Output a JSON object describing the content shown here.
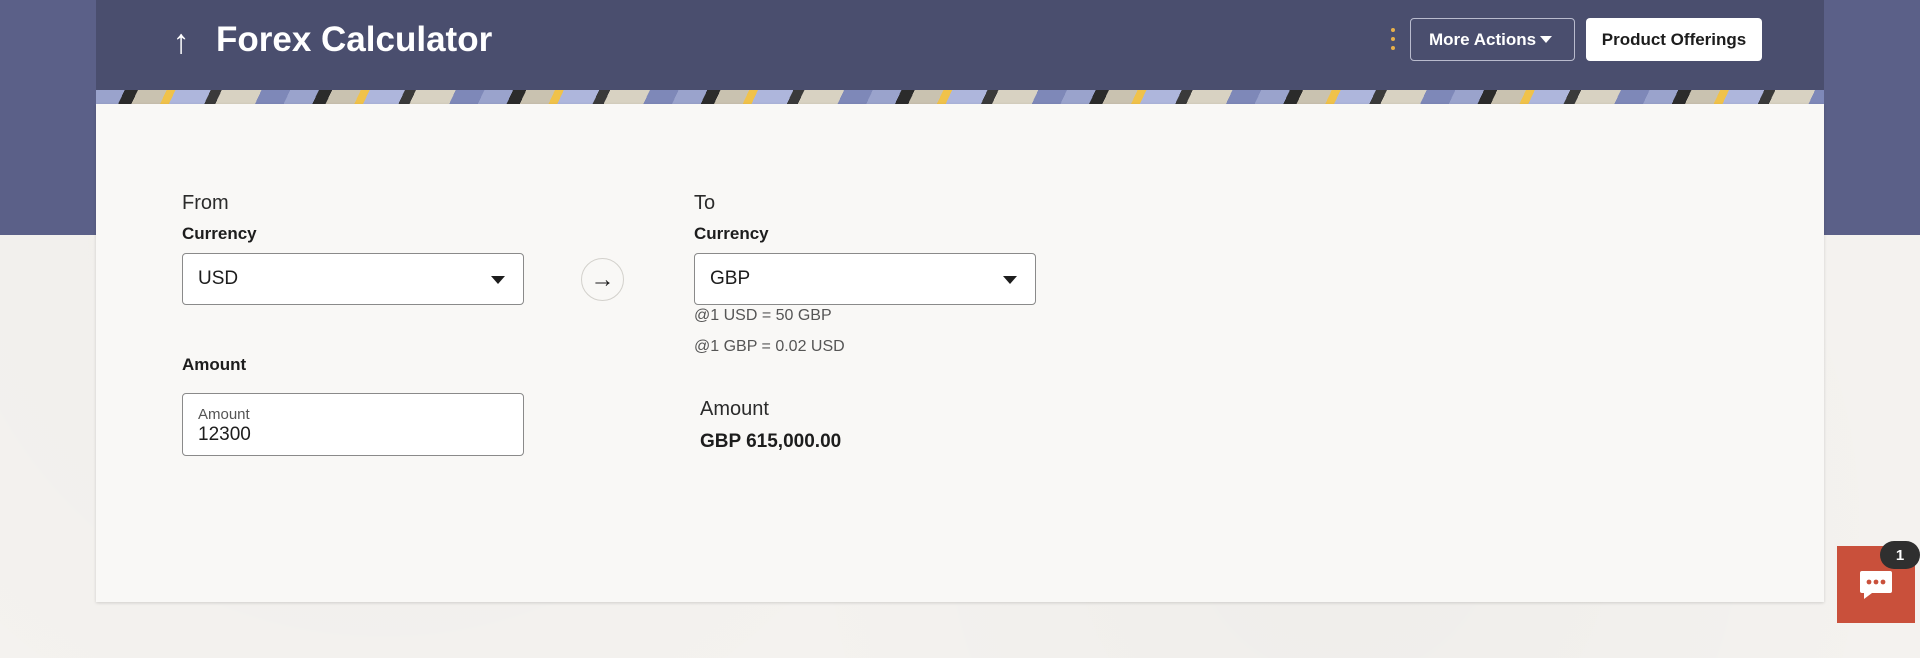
{
  "header": {
    "title": "Forex Calculator",
    "more_actions_label": "More Actions",
    "product_offerings_label": "Product Offerings"
  },
  "from": {
    "section_label": "From",
    "currency_label": "Currency",
    "currency_value": "USD",
    "amount_label": "Amount",
    "amount_float_label": "Amount",
    "amount_value": "12300"
  },
  "to": {
    "section_label": "To",
    "currency_label": "Currency",
    "currency_value": "GBP",
    "rate_line_1": "@1 USD = 50 GBP",
    "rate_line_2": "@1 GBP = 0.02 USD",
    "amount_label": "Amount",
    "amount_value": "GBP 615,000.00"
  },
  "chat": {
    "badge_count": "1"
  },
  "colors": {
    "header_bg": "#4a4e6e",
    "top_band": "#5b6088",
    "accent_chat": "#c9503b",
    "kebab": "#e8b04a"
  },
  "icons": {
    "back": "arrow-up-icon",
    "swap": "arrow-right-icon",
    "menu": "kebab-icon",
    "chat": "chat-icon"
  }
}
